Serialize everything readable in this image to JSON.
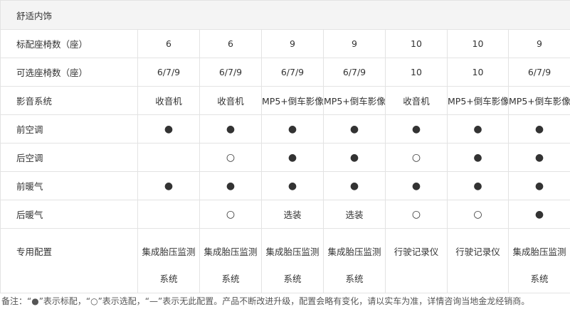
{
  "section_title": "舒适内饰",
  "rows": [
    {
      "label": "标配座椅数（座）",
      "cells": [
        "6",
        "6",
        "9",
        "9",
        "10",
        "10",
        "9"
      ]
    },
    {
      "label": "可选座椅数（座）",
      "cells": [
        "6/7/9",
        "6/7/9",
        "6/7/9",
        "6/7/9",
        "10",
        "10",
        "6/7/9"
      ]
    },
    {
      "label": "影音系统",
      "cells": [
        "收音机",
        "收音机",
        "MP5+倒车影像",
        "MP5+倒车影像",
        "收音机",
        "MP5+倒车影像",
        "MP5+倒车影像"
      ]
    },
    {
      "label": "前空调",
      "cells": [
        "●",
        "●",
        "●",
        "●",
        "●",
        "●",
        "●"
      ]
    },
    {
      "label": "后空调",
      "cells": [
        "",
        "○",
        "●",
        "●",
        "○",
        "●",
        "●"
      ]
    },
    {
      "label": "前暖气",
      "cells": [
        "●",
        "●",
        "●",
        "●",
        "●",
        "●",
        "●"
      ]
    },
    {
      "label": "后暖气",
      "cells": [
        "",
        "○",
        "选装",
        "选装",
        "○",
        "○",
        "●"
      ]
    },
    {
      "label": "专用配置",
      "cells": [
        "集成胎压监测系统",
        "集成胎压监测系统",
        "集成胎压监测系统",
        "集成胎压监测系统",
        "行驶记录仪",
        "行驶记录仪",
        "集成胎压监测系统"
      ]
    }
  ],
  "note": "备注：“●”表示标配，“○”表示选配，“—”表示无此配置。产品不断改进升级，配置会略有变化，请以实车为准，详情咨询当地金龙经销商。"
}
